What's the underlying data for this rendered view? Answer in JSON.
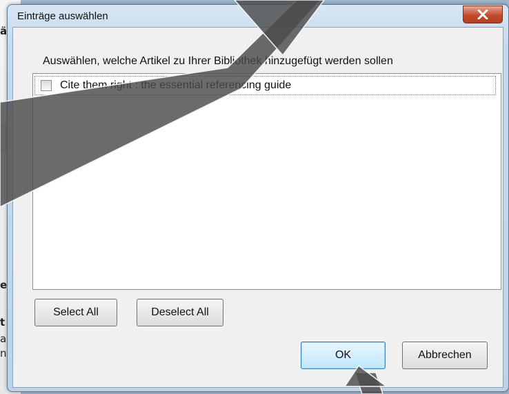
{
  "dialog": {
    "title": "Einträge auswählen",
    "instruction": "Auswählen, welche Artikel zu Ihrer Bibliothek hinzugefügt werden sollen",
    "items": [
      {
        "label": "Cite them right : the essential referencing guide",
        "checked": false
      }
    ],
    "buttons": {
      "select_all": "Select All",
      "deselect_all": "Deselect All",
      "ok": "OK",
      "cancel": "Abbrechen"
    }
  },
  "background_app": {
    "chars": [
      "ä",
      "e",
      "t",
      "a",
      "ne"
    ]
  },
  "colors": {
    "close_button": "#c44a2a",
    "ok_button_border": "#3c7fb1",
    "overlay_arrow": "#555555"
  }
}
